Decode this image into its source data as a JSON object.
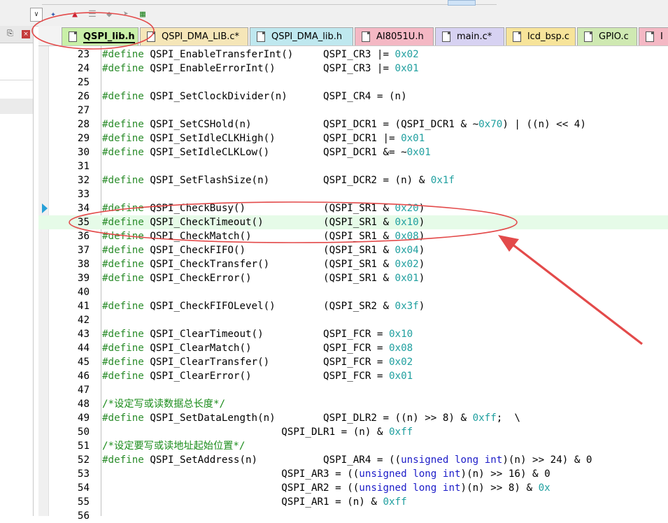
{
  "window": {
    "left_panel": {
      "pin_icon": "pin-icon",
      "close_icon": "close-icon"
    }
  },
  "tabs": [
    {
      "label": "QSPI_lib.h",
      "color": "#c9f0a8",
      "active": true
    },
    {
      "label": "QSPI_DMA_LIB.c*",
      "color": "#f5e6b8",
      "active": false
    },
    {
      "label": "QSPI_DMA_lib.h",
      "color": "#bfe8ef",
      "active": false
    },
    {
      "label": "AI8051U.h",
      "color": "#f4b8c4",
      "active": false
    },
    {
      "label": "main.c*",
      "color": "#d7d2f2",
      "active": false
    },
    {
      "label": "lcd_bsp.c",
      "color": "#f7e49a",
      "active": false
    },
    {
      "label": "GPIO.c",
      "color": "#cfe9b2",
      "active": false
    },
    {
      "label": "I",
      "color": "#f4b8c4",
      "active": false
    }
  ],
  "code": {
    "current_line": 35,
    "lines": [
      {
        "n": "23",
        "t": "#define QSPI_EnableTransferInt()     QSPI_CR3 |= 0x02"
      },
      {
        "n": "24",
        "t": "#define QSPI_EnableErrorInt()        QSPI_CR3 |= 0x01"
      },
      {
        "n": "25",
        "t": ""
      },
      {
        "n": "26",
        "t": "#define QSPI_SetClockDivider(n)      QSPI_CR4 = (n)"
      },
      {
        "n": "27",
        "t": ""
      },
      {
        "n": "28",
        "t": "#define QSPI_SetCSHold(n)            QSPI_DCR1 = (QSPI_DCR1 & ~0x70) | ((n) << 4)"
      },
      {
        "n": "29",
        "t": "#define QSPI_SetIdleCLKHigh()        QSPI_DCR1 |= 0x01"
      },
      {
        "n": "30",
        "t": "#define QSPI_SetIdleCLKLow()         QSPI_DCR1 &= ~0x01"
      },
      {
        "n": "31",
        "t": ""
      },
      {
        "n": "32",
        "t": "#define QSPI_SetFlashSize(n)         QSPI_DCR2 = (n) & 0x1f"
      },
      {
        "n": "33",
        "t": ""
      },
      {
        "n": "34",
        "t": "#define QSPI_CheckBusy()             (QSPI_SR1 & 0x20)"
      },
      {
        "n": "35",
        "t": "#define QSPI_CheckTimeout()          (QSPI_SR1 & 0x10)"
      },
      {
        "n": "36",
        "t": "#define QSPI_CheckMatch()            (QSPI_SR1 & 0x08)"
      },
      {
        "n": "37",
        "t": "#define QSPI_CheckFIFO()             (QSPI_SR1 & 0x04)"
      },
      {
        "n": "38",
        "t": "#define QSPI_CheckTransfer()         (QSPI_SR1 & 0x02)"
      },
      {
        "n": "39",
        "t": "#define QSPI_CheckError()            (QSPI_SR1 & 0x01)"
      },
      {
        "n": "40",
        "t": ""
      },
      {
        "n": "41",
        "t": "#define QSPI_CheckFIFOLevel()        (QSPI_SR2 & 0x3f)"
      },
      {
        "n": "42",
        "t": ""
      },
      {
        "n": "43",
        "t": "#define QSPI_ClearTimeout()          QSPI_FCR = 0x10"
      },
      {
        "n": "44",
        "t": "#define QSPI_ClearMatch()            QSPI_FCR = 0x08"
      },
      {
        "n": "45",
        "t": "#define QSPI_ClearTransfer()         QSPI_FCR = 0x02"
      },
      {
        "n": "46",
        "t": "#define QSPI_ClearError()            QSPI_FCR = 0x01"
      },
      {
        "n": "47",
        "t": ""
      },
      {
        "n": "48",
        "t": "/*设定写或读数据总长度*/"
      },
      {
        "n": "49",
        "t": "#define QSPI_SetDataLength(n)        QSPI_DLR2 = ((n) >> 8) & 0xff;  \\"
      },
      {
        "n": "50",
        "t": "                              QSPI_DLR1 = (n) & 0xff"
      },
      {
        "n": "51",
        "t": "/*设定要写或读地址起始位置*/"
      },
      {
        "n": "52",
        "t": "#define QSPI_SetAddress(n)           QSPI_AR4 = ((unsigned long int)(n) >> 24) & 0"
      },
      {
        "n": "53",
        "t": "                              QSPI_AR3 = ((unsigned long int)(n) >> 16) & 0"
      },
      {
        "n": "54",
        "t": "                              QSPI_AR2 = ((unsigned long int)(n) >> 8) & 0x"
      },
      {
        "n": "55",
        "t": "                              QSPI_AR1 = (n) & 0xff"
      },
      {
        "n": "56",
        "t": ""
      }
    ]
  }
}
